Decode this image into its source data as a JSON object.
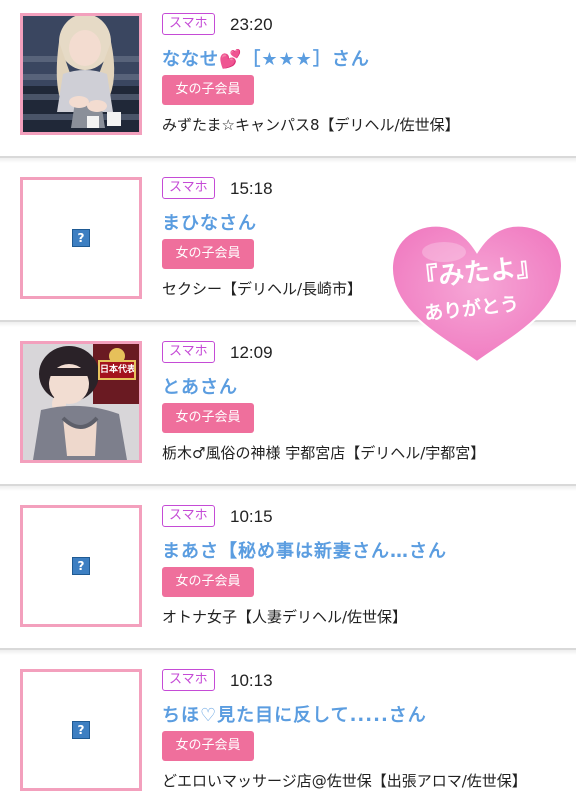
{
  "items": [
    {
      "device": "スマホ",
      "time": "23:20",
      "name": "ななせ💕［★★★］さん",
      "badge": "女の子会員",
      "shop": "みずたま☆キャンパス8【デリヘル/佐世保】",
      "image": "photo"
    },
    {
      "device": "スマホ",
      "time": "15:18",
      "name": "まひなさん",
      "badge": "女の子会員",
      "shop": "セクシー【デリヘル/長崎市】",
      "image": "missing",
      "missing_glyph": "?"
    },
    {
      "device": "スマホ",
      "time": "12:09",
      "name": "とあさん",
      "badge": "女の子会員",
      "shop": "栃木♂風俗の神様 宇都宮店【デリヘル/宇都宮】",
      "image": "photo",
      "image_text": "日本代表"
    },
    {
      "device": "スマホ",
      "time": "10:15",
      "name": "まあさ【秘め事は新妻さん…さん",
      "badge": "女の子会員",
      "shop": "オトナ女子【人妻デリヘル/佐世保】",
      "image": "missing",
      "missing_glyph": "?"
    },
    {
      "device": "スマホ",
      "time": "10:13",
      "name": "ちほ♡見た目に反して.....さん",
      "badge": "女の子会員",
      "shop": "どエロいマッサージ店@佐世保【出張アロマ/佐世保】",
      "image": "missing",
      "missing_glyph": "?"
    }
  ],
  "sticker": {
    "line1": "『みたよ』",
    "line2": "ありがとう"
  },
  "colors": {
    "name": "#5b9de0",
    "badge": "#ef6f9c",
    "device_border": "#c54bd6",
    "thumb_border": "#f3a0bd",
    "sticker": "#f27ac1"
  }
}
